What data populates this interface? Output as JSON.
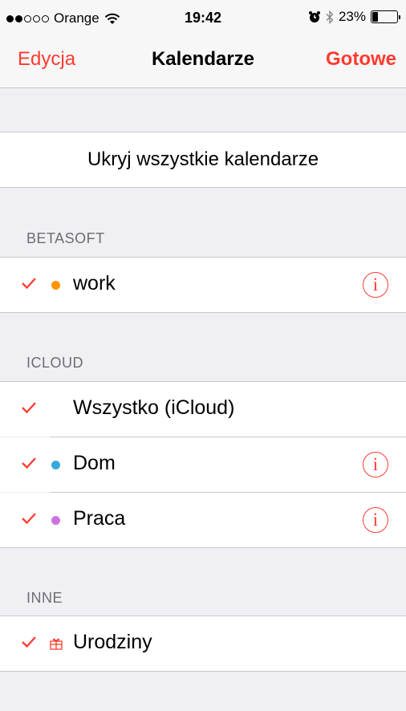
{
  "status_bar": {
    "carrier": "Orange",
    "time": "19:42",
    "battery": "23%",
    "battery_level": 0.23,
    "signal_bars_filled": 2,
    "signal_bars_total": 5,
    "icons": [
      "wifi-icon",
      "alarm-icon",
      "bluetooth-icon",
      "battery-icon"
    ]
  },
  "nav": {
    "left": "Edycja",
    "title": "Kalendarze",
    "right": "Gotowe"
  },
  "hide_all": "Ukryj wszystkie kalendarze",
  "sections": [
    {
      "header": "BETASOFT",
      "rows": [
        {
          "label": "work",
          "checked": true,
          "dot_color": "#ff9500",
          "info": true
        }
      ]
    },
    {
      "header": "ICLOUD",
      "rows": [
        {
          "label": "Wszystko (iCloud)",
          "checked": true,
          "info": false
        },
        {
          "label": "Dom",
          "checked": true,
          "dot_color": "#34aadc",
          "info": true
        },
        {
          "label": "Praca",
          "checked": true,
          "dot_color": "#cc73e1",
          "info": true
        }
      ]
    },
    {
      "header": "INNE",
      "rows": [
        {
          "label": "Urodziny",
          "checked": true,
          "icon": "gift-icon",
          "info": false
        }
      ]
    }
  ],
  "info_glyph": "i",
  "colors": {
    "accent": "#ff3b30",
    "background": "#efeff4",
    "separator": "#c8c7cc",
    "header_text": "#6d6d72"
  }
}
